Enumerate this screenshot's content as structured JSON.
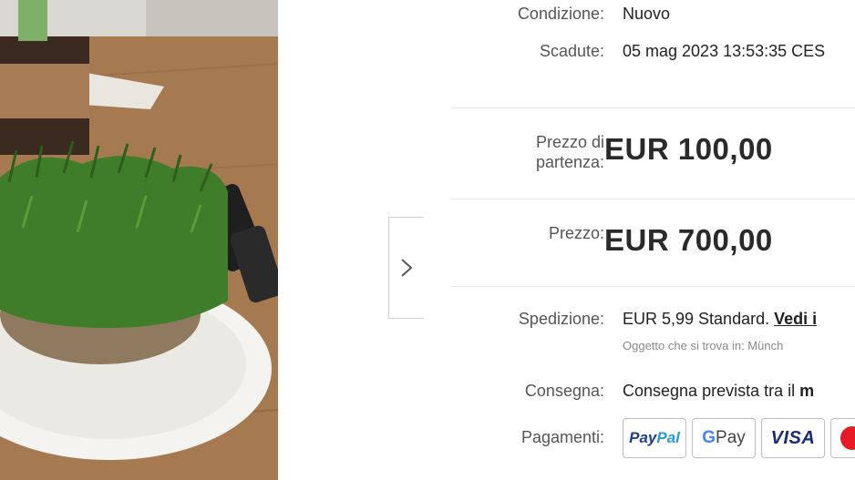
{
  "listing": {
    "condition_label": "Condizione:",
    "condition_value": "Nuovo",
    "expires_label": "Scadute:",
    "expires_value": "05 mag 2023 13:53:35 CES",
    "start_price_label_line1": "Prezzo di",
    "start_price_label_line2": "partenza:",
    "start_price_value": "EUR 100,00",
    "price_label": "Prezzo:",
    "price_value": "EUR 700,00",
    "shipping_label": "Spedizione:",
    "shipping_value": "EUR 5,99 Standard.",
    "shipping_link": "Vedi i",
    "location_note": "Oggetto che si trova in: Münch",
    "delivery_label": "Consegna:",
    "delivery_value": "Consegna prevista tra il",
    "delivery_value_bold": "m",
    "payments_label": "Pagamenti:"
  },
  "payments": {
    "paypal_part1": "Pay",
    "paypal_part2": "Pal",
    "gpay_g": "G",
    "gpay_text": " Pay",
    "visa": "VISA"
  },
  "icons": {
    "next": "chevron-right-icon"
  },
  "colors": {
    "price_text": "#2a2a2a",
    "label_text": "#555555",
    "grass": "#3f7d2a",
    "table_wood": "#9c7049"
  }
}
